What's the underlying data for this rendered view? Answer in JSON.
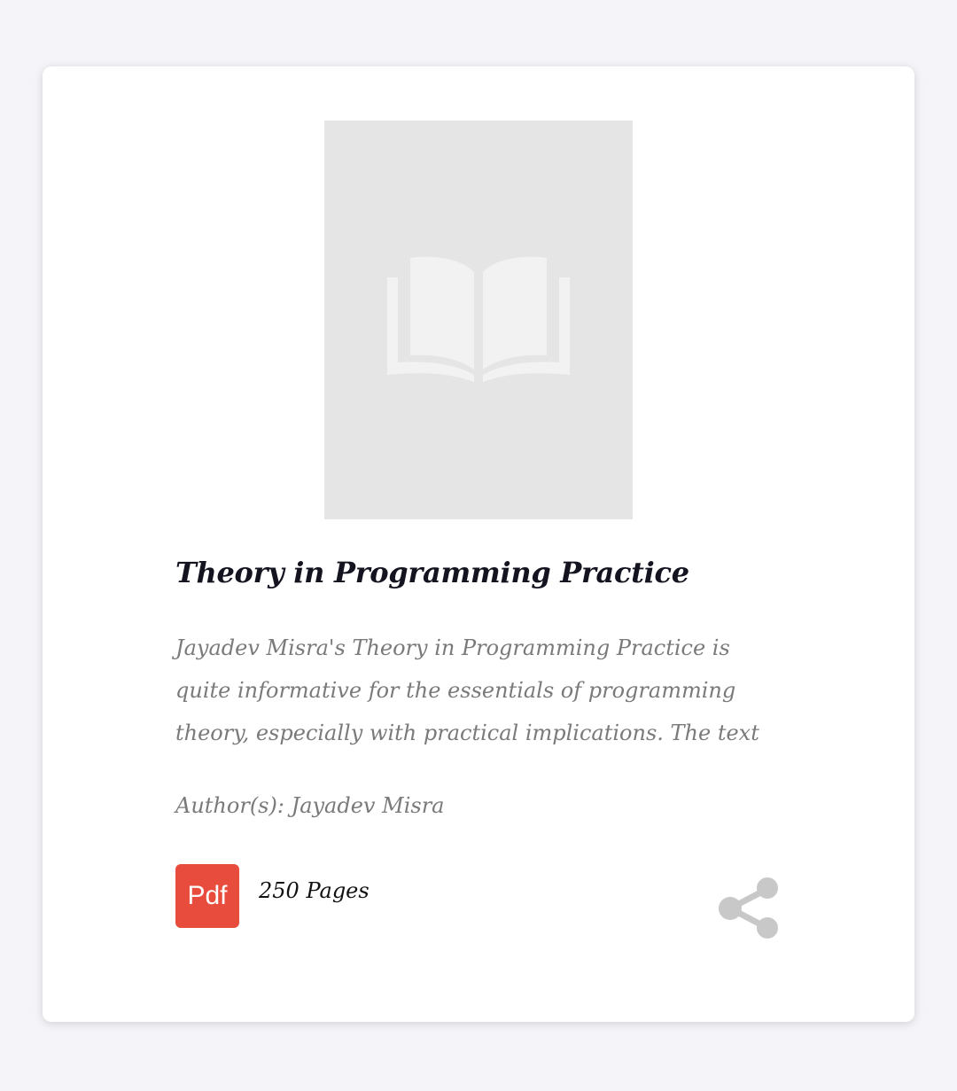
{
  "book": {
    "cover_icon": "open-book-icon",
    "title": "Theory in Programming Practice",
    "description": "Jayadev Misra's Theory in Programming Practice is quite informative for the essentials of programming theory, especially with practical implications. The text",
    "authors": "Author(s): Jayadev Misra",
    "format_badge": "Pdf",
    "pages": "250 Pages",
    "share_icon": "share-icon"
  },
  "colors": {
    "background": "#f5f5f9",
    "card": "#ffffff",
    "cover_placeholder": "#e5e5e5",
    "pdf_badge": "#e74c3c",
    "muted_text": "#7a7a7a",
    "title_text": "#141420",
    "share_icon": "#c8c8c8"
  }
}
